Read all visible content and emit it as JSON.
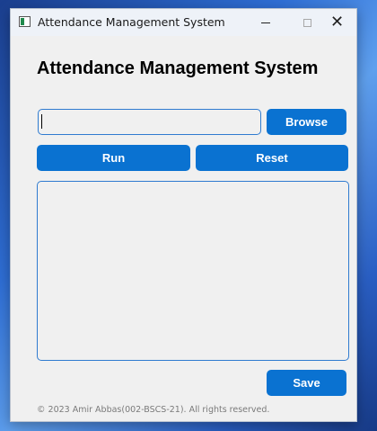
{
  "window": {
    "title": "Attendance Management System",
    "icon": "app-window-icon"
  },
  "controls": {
    "minimize": "minimize-icon",
    "maximize": "maximize-icon",
    "close_glyph": "✕"
  },
  "main": {
    "heading": "Attendance Management System",
    "path_input": {
      "value": "",
      "placeholder": ""
    },
    "browse_label": "Browse",
    "run_label": "Run",
    "reset_label": "Reset",
    "output_text": "",
    "save_label": "Save",
    "footer": "© 2023 Amir Abbas(002-BSCS-21). All rights reserved."
  },
  "colors": {
    "accent": "#0a72d1",
    "window_bg": "#f0f0f0"
  }
}
